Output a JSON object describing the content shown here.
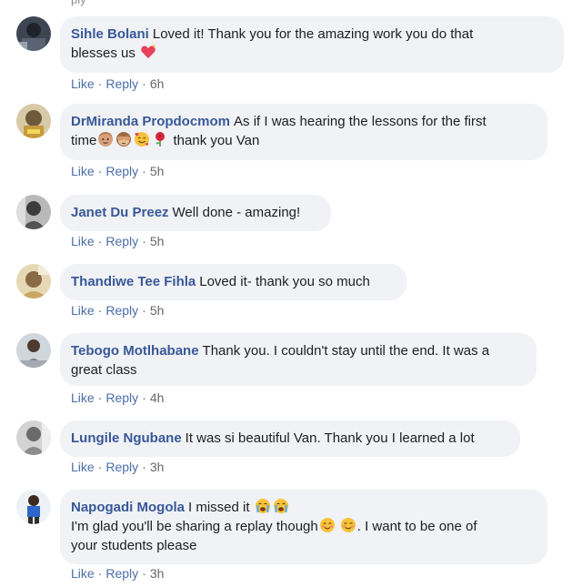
{
  "top_fragment": "ply",
  "comments": [
    {
      "author": "Sihle Bolani",
      "text_1": "Loved it! Thank you for the amazing work you do that",
      "text_2": "blesses us",
      "emojis": [
        "sparkling-heart-icon"
      ],
      "like": "Like",
      "reply": "Reply",
      "time": "6h"
    },
    {
      "author": "DrMiranda Propdocmom",
      "text_1": "As if I was hearing the lessons for the first",
      "text_2": "time",
      "text_3": "thank you Van",
      "emojis": [
        "person-icon",
        "see-no-evil-monkey-icon",
        "smiling-face-with-hearts-icon",
        "rose-icon"
      ],
      "like": "Like",
      "reply": "Reply",
      "time": "5h"
    },
    {
      "author": "Janet Du Preez",
      "text_1": "Well done - amazing!",
      "like": "Like",
      "reply": "Reply",
      "time": "5h"
    },
    {
      "author": "Thandiwe Tee Fihla",
      "text_1": "Loved it- thank you so much",
      "like": "Like",
      "reply": "Reply",
      "time": "5h"
    },
    {
      "author": "Tebogo Motlhabane",
      "text_1": "Thank you. I couldn't stay until the end. It was a",
      "text_2": "great class",
      "like": "Like",
      "reply": "Reply",
      "time": "4h"
    },
    {
      "author": "Lungile Ngubane",
      "text_1": "It was si beautiful Van. Thank you I learned a lot",
      "like": "Like",
      "reply": "Reply",
      "time": "3h"
    },
    {
      "author": "Napogadi Mogola",
      "text_1": "I missed it",
      "text_2": "I'm glad you'll be sharing a replay though",
      "text_3": ". I want to be one of",
      "text_4": "your students please",
      "emojis": [
        "crying-face-icon",
        "crying-face-icon",
        "smiling-face-icon",
        "smiling-face-icon"
      ],
      "like": "Like",
      "reply": "Reply",
      "time": "3h"
    }
  ],
  "colors": {
    "bubble": "#f0f2f5",
    "author": "#385898",
    "action": "#4b6ea8",
    "text": "#1c1e21",
    "meta": "#65676b"
  }
}
